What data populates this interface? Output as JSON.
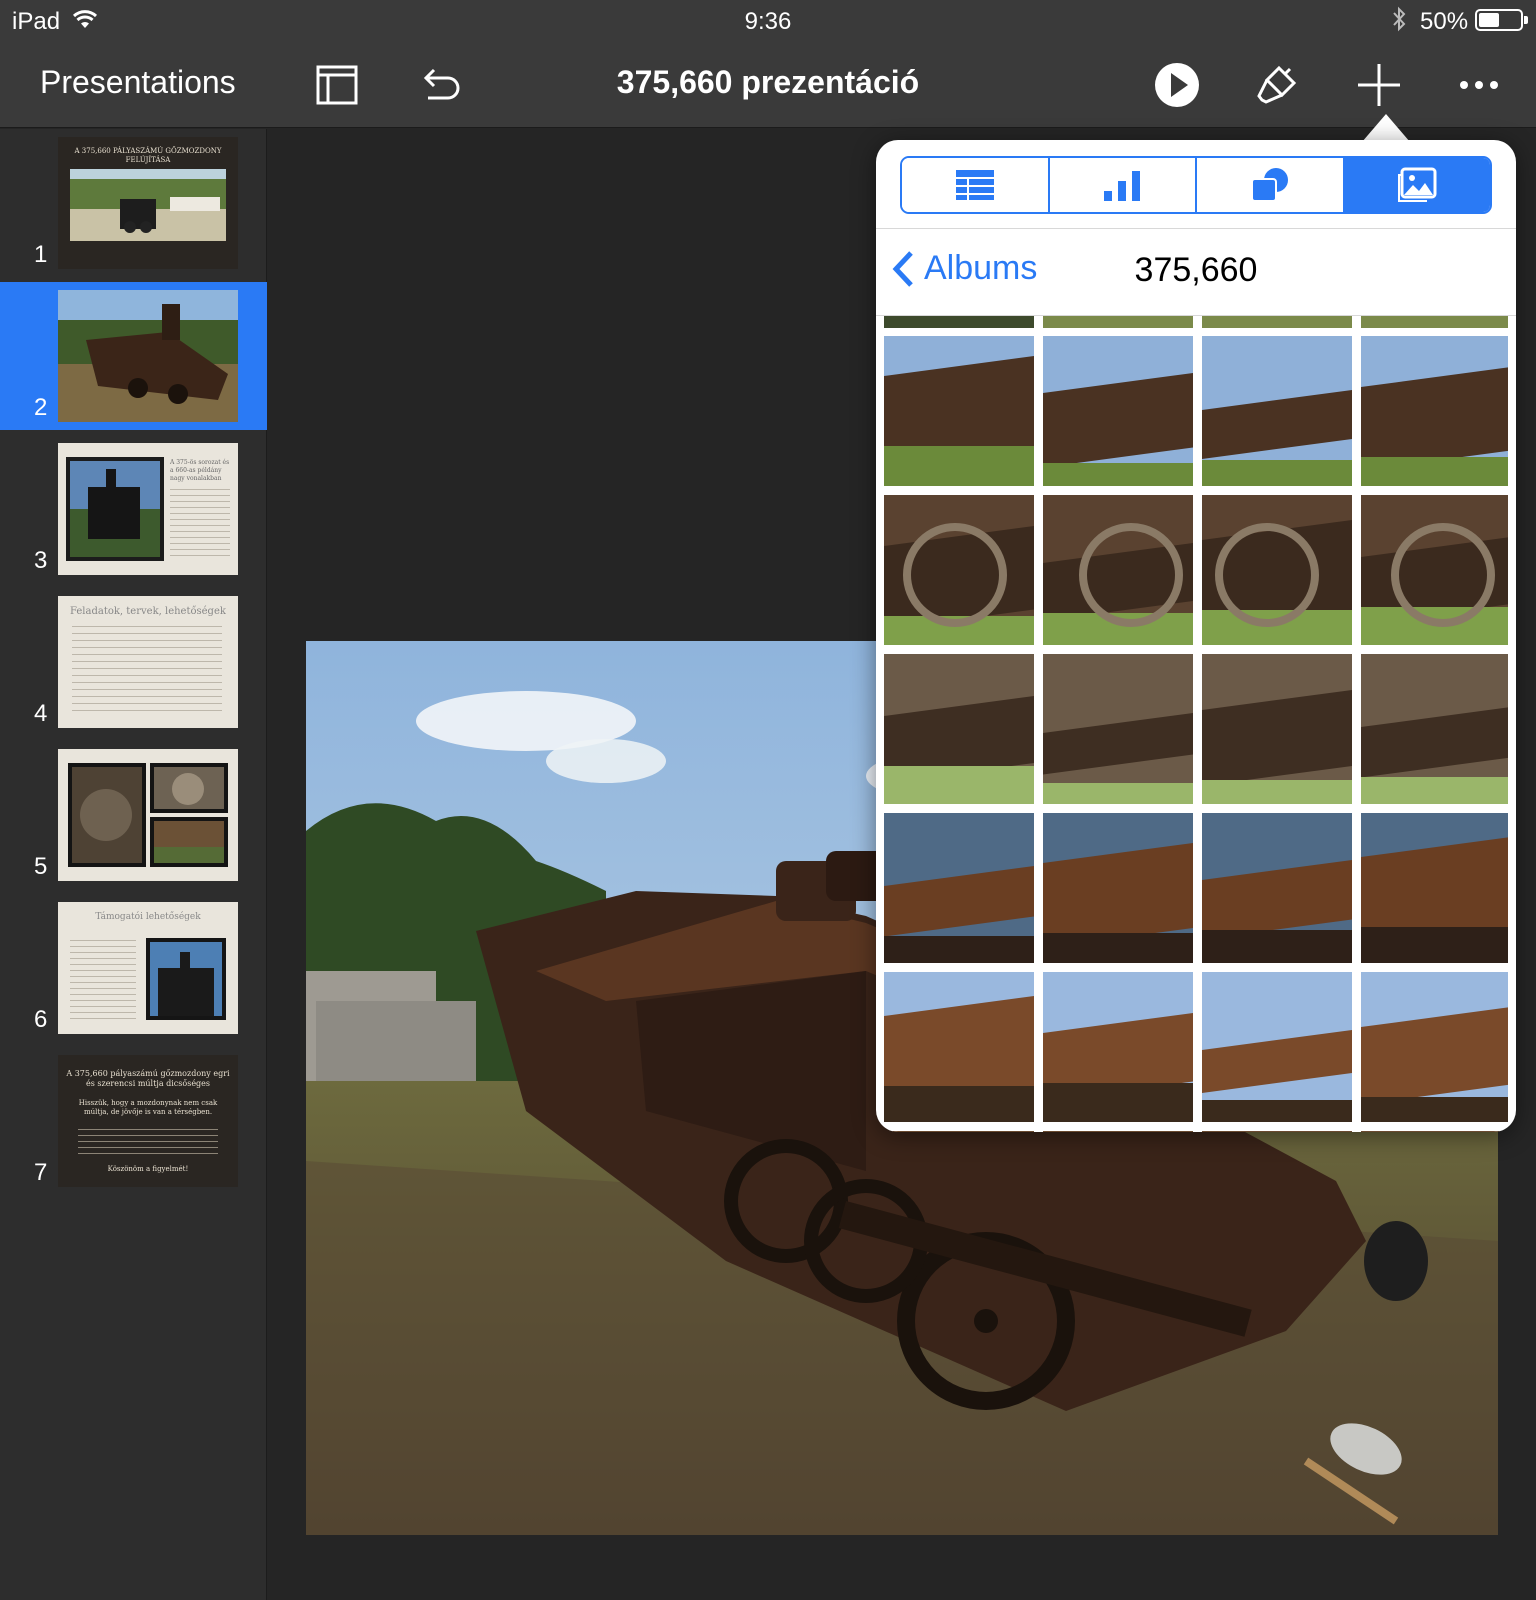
{
  "status_bar": {
    "device": "iPad",
    "time": "9:36",
    "battery_percent": "50%",
    "battery_level": 0.5
  },
  "toolbar": {
    "back_label": "Presentations",
    "title": "375,660 prezentáció"
  },
  "navigator": {
    "slides": [
      {
        "number": "1",
        "title": "A 375,660 PÁLYASZÁMÚ GŐZMOZDONY FELÚJÍTÁSA",
        "selected": false
      },
      {
        "number": "2",
        "title": "",
        "selected": true
      },
      {
        "number": "3",
        "title": "A 375-ös sorozat és a 660-as példány nagy vonalakban",
        "selected": false
      },
      {
        "number": "4",
        "title": "Feladatok, tervek, lehetőségek",
        "selected": false
      },
      {
        "number": "5",
        "title": "",
        "selected": false
      },
      {
        "number": "6",
        "title": "Támogatói lehetőségek",
        "selected": false
      },
      {
        "number": "7",
        "title": "A 375,660 pályaszámú gőzmozdony egri és szerencsi múltja dicsőséges",
        "body": "Hisszük, hogy a mozdonynak nem csak múltja, de jövője is van a térségben.",
        "closing": "Köszönöm a figyelmét!",
        "selected": false
      }
    ]
  },
  "popover": {
    "tabs": [
      {
        "icon": "table-icon",
        "active": false
      },
      {
        "icon": "chart-icon",
        "active": false
      },
      {
        "icon": "shapes-icon",
        "active": false
      },
      {
        "icon": "media-icon",
        "active": true
      }
    ],
    "back_label": "Albums",
    "album_name": "375,660",
    "photo_rows": 5,
    "photo_cols": 4
  },
  "colors": {
    "accent": "#2a7af5",
    "toolbar_bg": "#3a3a3a",
    "canvas_bg": "#252525"
  }
}
